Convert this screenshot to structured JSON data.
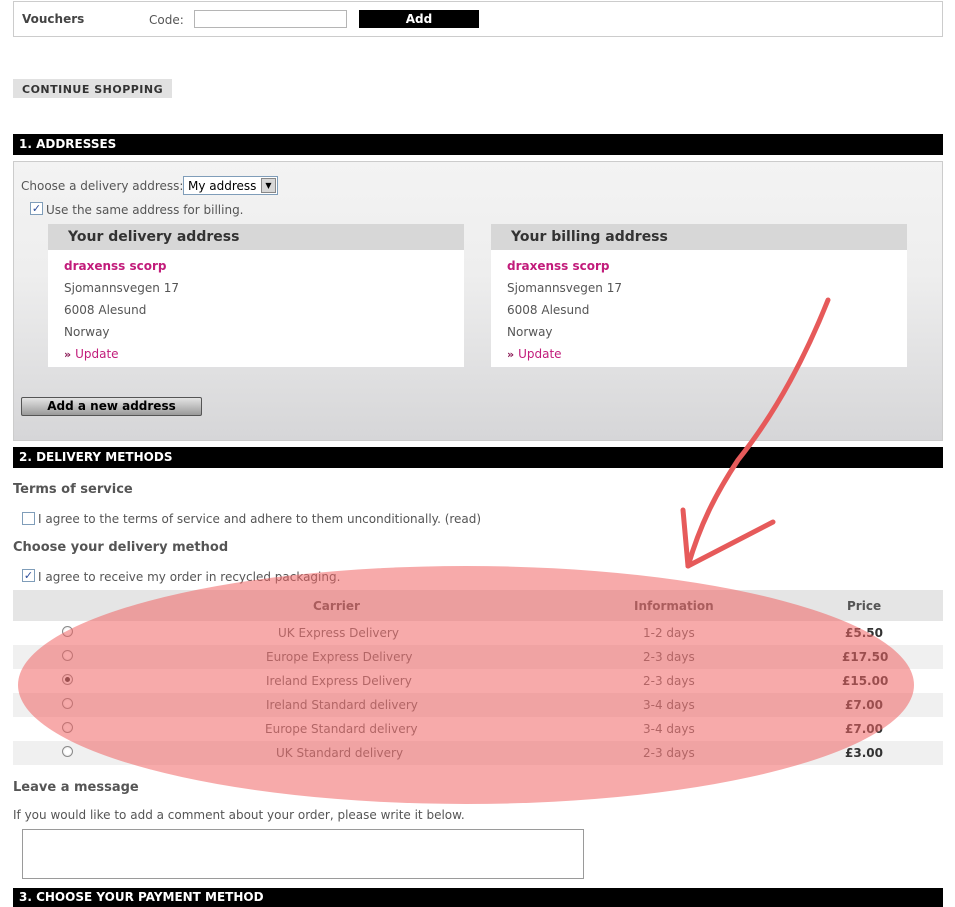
{
  "vouchers": {
    "title": "Vouchers",
    "code_label": "Code:",
    "code_value": "",
    "add_label": "Add"
  },
  "continue_shopping": "CONTINUE SHOPPING",
  "addresses": {
    "heading": "1. ADDRESSES",
    "choose_label": "Choose a delivery address:",
    "selected_address": "My address",
    "same_address_label": "Use the same address for billing.",
    "same_address_checked": true,
    "delivery": {
      "title": "Your delivery address",
      "name": "draxenss scorp",
      "street": "Sjomannsvegen 17",
      "city": "6008 Alesund",
      "country": "Norway",
      "update": "Update"
    },
    "billing": {
      "title": "Your billing address",
      "name": "draxenss scorp",
      "street": "Sjomannsvegen 17",
      "city": "6008 Alesund",
      "country": "Norway",
      "update": "Update"
    },
    "add_new": "Add a new address"
  },
  "delivery": {
    "heading": "2. DELIVERY METHODS",
    "terms_title": "Terms of service",
    "terms_label": "I agree to the terms of service and adhere to them unconditionally. (read)",
    "terms_checked": false,
    "method_title": "Choose your delivery method",
    "recycled_label": "I agree to receive my order in recycled packaging.",
    "recycled_checked": true,
    "columns": [
      "Carrier",
      "Information",
      "Price"
    ],
    "carriers": [
      {
        "carrier": "UK Express Delivery",
        "info": "1-2 days",
        "price": "£5.50",
        "selected": false
      },
      {
        "carrier": "Europe Express Delivery",
        "info": "2-3 days",
        "price": "£17.50",
        "selected": false
      },
      {
        "carrier": "Ireland Express Delivery",
        "info": "2-3 days",
        "price": "£15.00",
        "selected": true
      },
      {
        "carrier": "Ireland Standard delivery",
        "info": "3-4 days",
        "price": "£7.00",
        "selected": false
      },
      {
        "carrier": "Europe Standard delivery",
        "info": "3-4 days",
        "price": "£7.00",
        "selected": false
      },
      {
        "carrier": "UK Standard delivery",
        "info": "2-3 days",
        "price": "£3.00",
        "selected": false
      }
    ],
    "message_title": "Leave a message",
    "message_note": "If you would like to add a comment about your order, please write it below.",
    "message_value": ""
  },
  "payment": {
    "heading": "3. CHOOSE YOUR PAYMENT METHOD"
  },
  "colors": {
    "accent": "#c21c7b",
    "section_bar": "#000000",
    "annotation": "#f06464"
  }
}
